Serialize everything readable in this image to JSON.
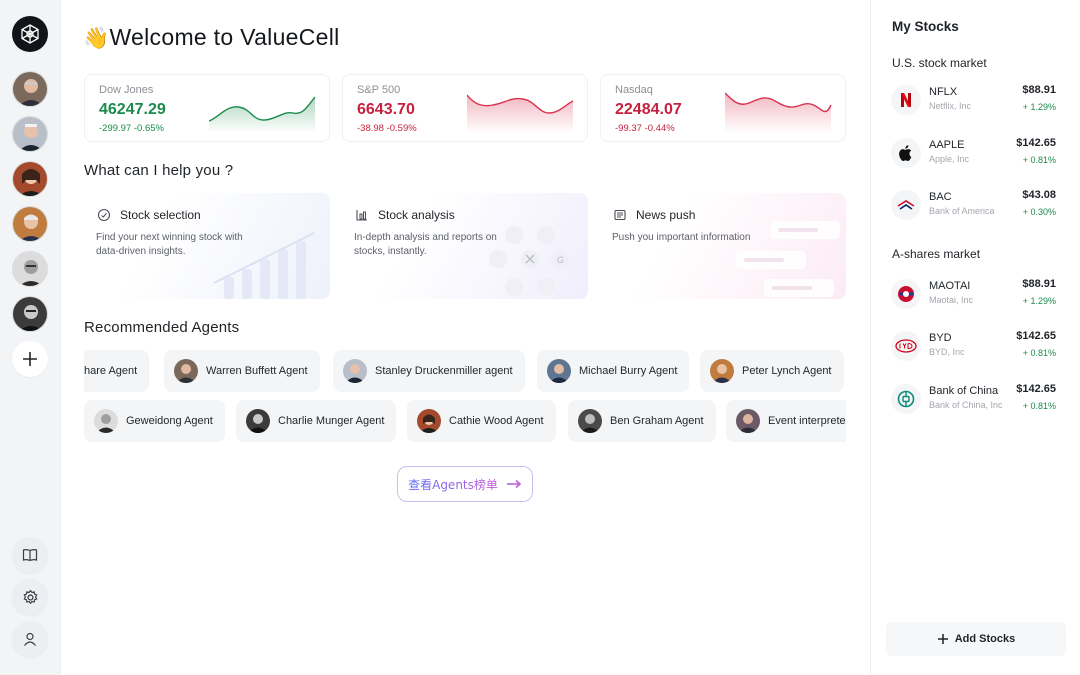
{
  "main": {
    "welcome_emoji": "👋",
    "welcome_title": "Welcome to ValueCell",
    "indices": [
      {
        "name": "Dow Jones",
        "value": "46247.29",
        "change": "-299.97",
        "percent": "-0.65%",
        "trend": "up"
      },
      {
        "name": "S&P 500",
        "value": "6643.70",
        "change": "-38.98",
        "percent": "-0.59%",
        "trend": "down"
      },
      {
        "name": "Nasdaq",
        "value": "22484.07",
        "change": "-99.37",
        "percent": "-0.44%",
        "trend": "down"
      }
    ],
    "help_heading": "What can I help you ?",
    "help_cards": [
      {
        "title": "Stock selection",
        "icon": "target-icon",
        "desc": "Find your next winning stock with data-driven insights."
      },
      {
        "title": "Stock analysis",
        "icon": "chart-icon",
        "desc": "In-depth analysis and reports on  stocks, instantly."
      },
      {
        "title": "News push",
        "icon": "news-icon",
        "desc": "Push you important information"
      }
    ],
    "agents_heading": "Recommended Agents",
    "agents_row1": [
      "hare Agent",
      "Warren Buffett Agent",
      "Stanley Druckenmiller agent",
      "Michael Burry Agent",
      "Peter Lynch Agent"
    ],
    "agents_row2": [
      "Geweidong Agent",
      "Charlie Munger Agent",
      "Cathie Wood Agent",
      "Ben Graham Agent",
      "Event interprete"
    ],
    "rank_button": "查看Agents榜单"
  },
  "right": {
    "title": "My Stocks",
    "us_section": "U.S. stock market",
    "us_stocks": [
      {
        "symbol": "NFLX",
        "name": "Netflix, Inc",
        "price": "$88.91",
        "change": "+ 1.29%",
        "icon": "netflix-logo-icon"
      },
      {
        "symbol": "AAPLE",
        "name": "Apple, Inc",
        "price": "$142.65",
        "change": "+ 0.81%",
        "icon": "apple-logo-icon"
      },
      {
        "symbol": "BAC",
        "name": "Bank of America",
        "price": "$43.08",
        "change": "+ 0.30%",
        "icon": "bank-of-america-logo-icon"
      }
    ],
    "a_section": "A-shares market",
    "a_stocks": [
      {
        "symbol": "MAOTAI",
        "name": "Maotai, Inc",
        "price": "$88.91",
        "change": "+ 1.29%",
        "icon": "maotai-logo-icon"
      },
      {
        "symbol": "BYD",
        "name": "BYD, Inc",
        "price": "$142.65",
        "change": "+ 0.81%",
        "icon": "byd-logo-icon"
      },
      {
        "symbol": "Bank of China",
        "name": "Bank of China, Inc",
        "price": "$142.65",
        "change": "+ 0.81%",
        "icon": "bank-of-china-logo-icon"
      }
    ],
    "add_button": "Add Stocks"
  },
  "colors": {
    "up": "#1b8a4c",
    "down": "#c6213f",
    "accent_start": "#5b6cf2",
    "accent_end": "#c75bd4"
  }
}
